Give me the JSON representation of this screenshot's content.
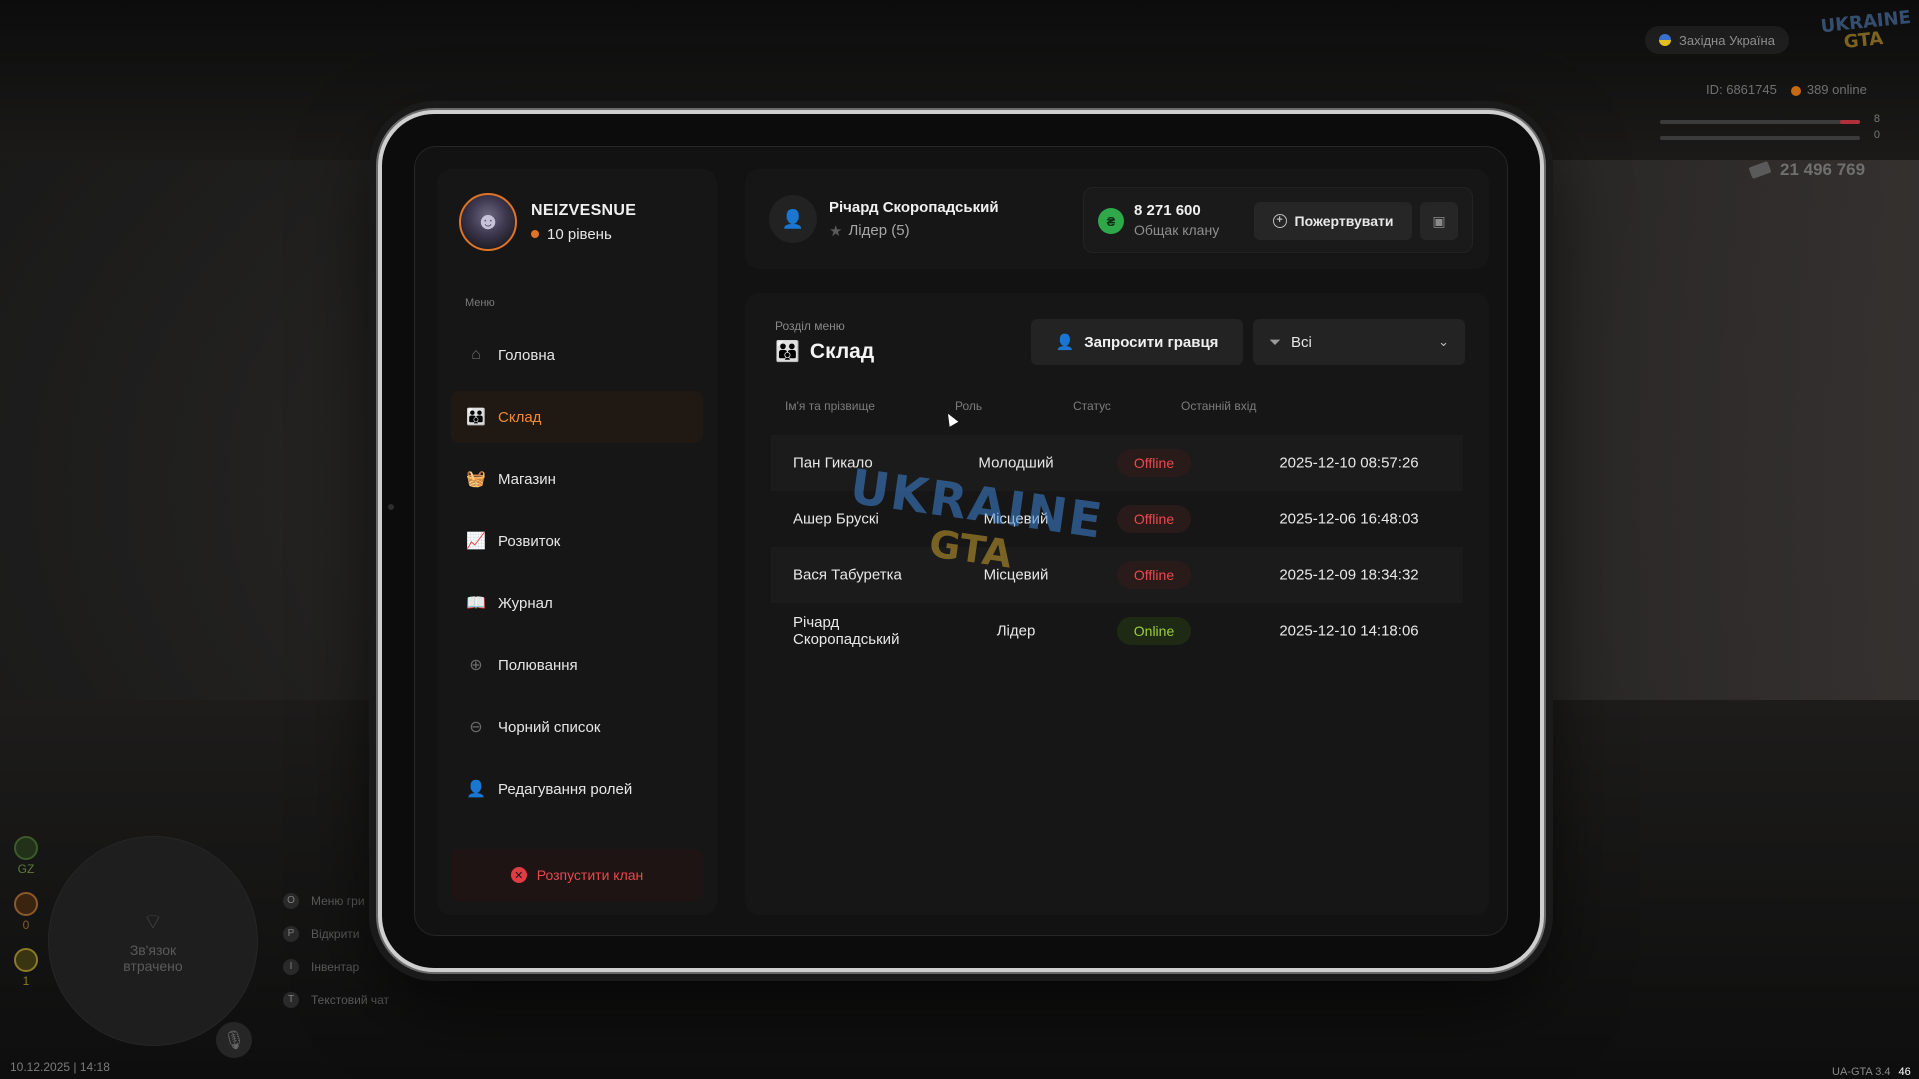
{
  "hud": {
    "region": "Західна Україна",
    "logo_top": "UKRAINE",
    "logo_bottom": "GTA",
    "id": "ID: 6861745",
    "online": "389 online",
    "bar1_value": "8",
    "bar2_value": "0",
    "money": "21 496 769",
    "minimap_text": "Зв'язок втрачено",
    "datetime": "10.12.2025 | 14:18",
    "version": "UA-GTA 3.4",
    "version_suffix": "46",
    "hints": [
      {
        "key": "O",
        "label": "Меню гри"
      },
      {
        "key": "P",
        "label": "Відкрити"
      },
      {
        "key": "I",
        "label": "Інвентар"
      },
      {
        "key": "T",
        "label": "Текстовий чат"
      }
    ],
    "stats": [
      "GZ",
      "0",
      "1"
    ]
  },
  "profile": {
    "nick": "NEIZVESNUE",
    "level": "10 рівень"
  },
  "menu": {
    "caption": "Меню",
    "items": [
      {
        "label": "Головна",
        "icon": "home-icon"
      },
      {
        "label": "Склад",
        "icon": "members-icon",
        "active": true
      },
      {
        "label": "Магазин",
        "icon": "shop-icon"
      },
      {
        "label": "Розвиток",
        "icon": "chart-icon"
      },
      {
        "label": "Журнал",
        "icon": "book-icon"
      },
      {
        "label": "Полювання",
        "icon": "crosshair-icon"
      },
      {
        "label": "Чорний список",
        "icon": "blocked-icon"
      },
      {
        "label": "Редагування ролей",
        "icon": "user-edit-icon"
      }
    ],
    "disband": "Розпустити клан"
  },
  "leader": {
    "name": "Річард Скоропадський",
    "role": "Лідер (5)"
  },
  "bank": {
    "amount": "8 271 600",
    "label": "Общак клану",
    "donate": "Пожертвувати"
  },
  "section": {
    "caption": "Розділ меню",
    "title": "Склад",
    "invite": "Запросити гравця",
    "filter": "Всі"
  },
  "table": {
    "headers": [
      "Ім'я та прізвище",
      "Роль",
      "Статус",
      "Останній вхід"
    ],
    "rows": [
      {
        "name": "Пан Гикало",
        "role": "Молодший",
        "status": "Offline",
        "last": "2025-12-10 08:57:26"
      },
      {
        "name": "Ашер Бруcкі",
        "role": "Місцевий",
        "status": "Offline",
        "last": "2025-12-06 16:48:03"
      },
      {
        "name": "Вася Табуретка",
        "role": "Місцевий",
        "status": "Offline",
        "last": "2025-12-09 18:34:32"
      },
      {
        "name": "Річард Скоропадський",
        "role": "Лідер",
        "status": "Online",
        "last": "2025-12-10 14:18:06"
      }
    ]
  },
  "colors": {
    "accent": "#f08a34",
    "danger": "#e8484c",
    "online": "#9ccf3c",
    "offline": "#e84a4a",
    "coin": "#2fa84a"
  }
}
